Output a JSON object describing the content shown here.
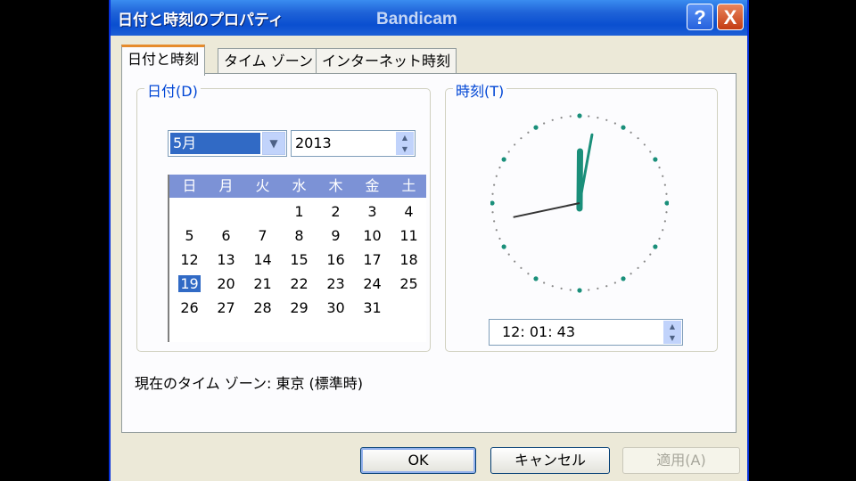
{
  "window": {
    "title": "日付と時刻のプロパティ",
    "watermark": "Bandicam",
    "help_glyph": "?",
    "close_glyph": "X"
  },
  "tabs": [
    {
      "label": "日付と時刻",
      "active": true
    },
    {
      "label": "タイム ゾーン",
      "active": false
    },
    {
      "label": "インターネット時刻",
      "active": false
    }
  ],
  "date_group": {
    "legend": "日付(D)",
    "month": "5月",
    "year": "2013",
    "weekdays": [
      "日",
      "月",
      "火",
      "水",
      "木",
      "金",
      "土"
    ],
    "weeks": [
      [
        "",
        "",
        "",
        "1",
        "2",
        "3",
        "4"
      ],
      [
        "5",
        "6",
        "7",
        "8",
        "9",
        "10",
        "11"
      ],
      [
        "12",
        "13",
        "14",
        "15",
        "16",
        "17",
        "18"
      ],
      [
        "19",
        "20",
        "21",
        "22",
        "23",
        "24",
        "25"
      ],
      [
        "26",
        "27",
        "28",
        "29",
        "30",
        "31",
        ""
      ]
    ],
    "selected_day": "19"
  },
  "time_group": {
    "legend": "時刻(T)",
    "time_value": "12: 01: 43",
    "clock": {
      "hour": 12,
      "minute": 1,
      "second": 43
    }
  },
  "status": {
    "timezone_text": "現在のタイム ゾーン: 東京 (標準時)"
  },
  "buttons": {
    "ok": "OK",
    "cancel": "キャンセル",
    "apply": "適用(A)"
  },
  "colors": {
    "title_bar": "#0a4fd0",
    "selection": "#316ac5",
    "calendar_header": "#7c92d6",
    "clock_hand": "#1a8f7a"
  }
}
